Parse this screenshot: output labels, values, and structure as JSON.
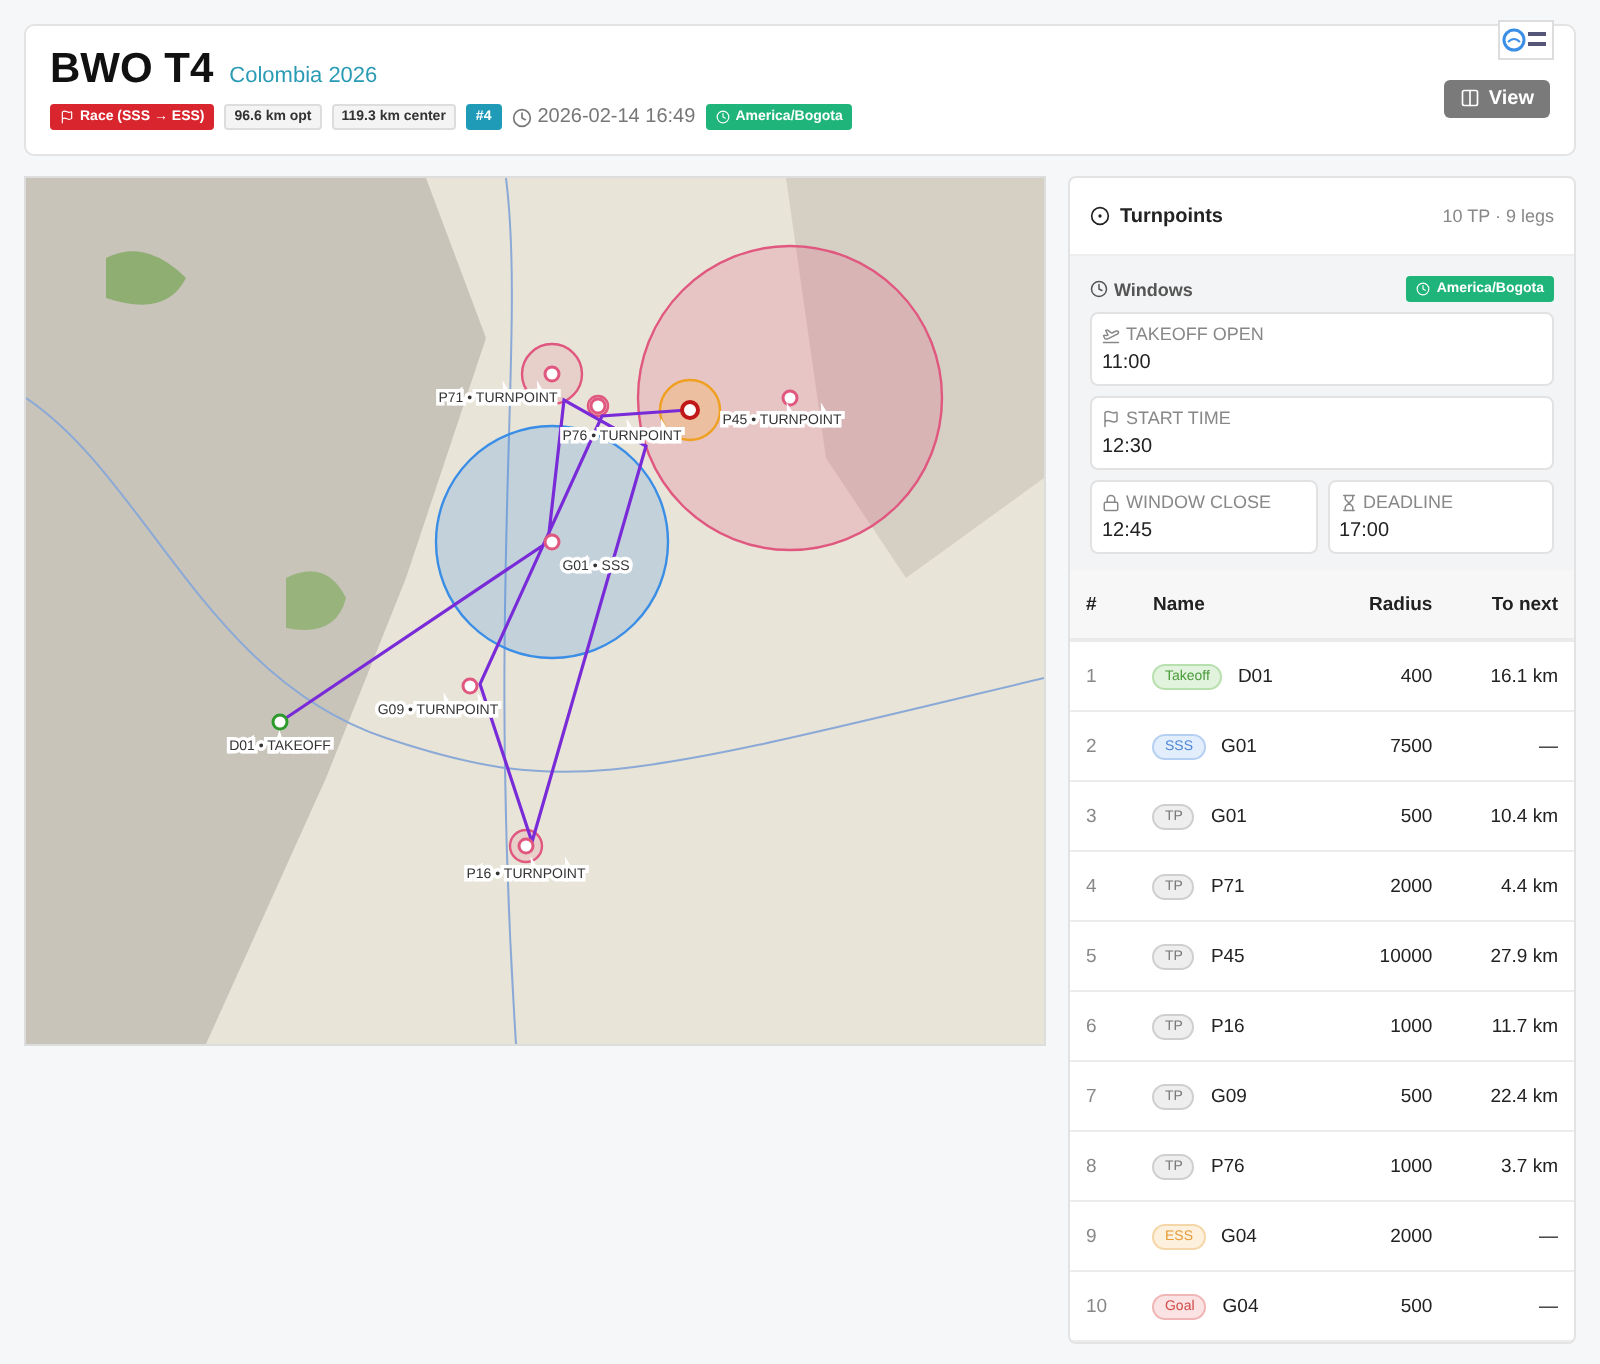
{
  "header": {
    "title": "BWO T4",
    "subtitle": "Colombia 2026",
    "task_type": "Race (SSS → ESS)",
    "distance_opt": "96.6 km opt",
    "distance_center": "119.3 km center",
    "task_number": "#4",
    "datetime": "2026-02-14 16:49",
    "timezone": "America/Bogota",
    "view_button": "View"
  },
  "map": {
    "waypoints": [
      {
        "label": "P71 • TURNPOINT",
        "kind": "tp"
      },
      {
        "label": "P45 • TURNPOINT",
        "kind": "tp"
      },
      {
        "label": "P76 • TURNPOINT",
        "kind": "tp"
      },
      {
        "label": "G01 • SSS",
        "kind": "sss"
      },
      {
        "label": "G09 • TURNPOINT",
        "kind": "tp"
      },
      {
        "label": "D01 • TAKEOFF",
        "kind": "takeoff"
      },
      {
        "label": "P16 • TURNPOINT",
        "kind": "tp"
      }
    ]
  },
  "turnpoints": {
    "title": "Turnpoints",
    "summary": "10 TP · 9 legs",
    "windows": {
      "title": "Windows",
      "timezone": "America/Bogota",
      "items": [
        {
          "kind": "takeoff",
          "label": "TAKEOFF OPEN",
          "time": "11:00"
        },
        {
          "kind": "start",
          "label": "START TIME",
          "time": "12:30"
        },
        {
          "kind": "close",
          "label": "WINDOW CLOSE",
          "time": "12:45"
        },
        {
          "kind": "deadline",
          "label": "DEADLINE",
          "time": "17:00"
        }
      ]
    },
    "columns": [
      "#",
      "Name",
      "Radius",
      "To next"
    ],
    "rows": [
      {
        "n": "1",
        "kind": "takeoff",
        "tag": "Takeoff",
        "name": "D01",
        "radius": "400",
        "to_next": "16.1 km"
      },
      {
        "n": "2",
        "kind": "sss",
        "tag": "SSS",
        "name": "G01",
        "radius": "7500",
        "to_next": "—"
      },
      {
        "n": "3",
        "kind": "tp",
        "tag": "TP",
        "name": "G01",
        "radius": "500",
        "to_next": "10.4 km"
      },
      {
        "n": "4",
        "kind": "tp",
        "tag": "TP",
        "name": "P71",
        "radius": "2000",
        "to_next": "4.4 km"
      },
      {
        "n": "5",
        "kind": "tp",
        "tag": "TP",
        "name": "P45",
        "radius": "10000",
        "to_next": "27.9 km"
      },
      {
        "n": "6",
        "kind": "tp",
        "tag": "TP",
        "name": "P16",
        "radius": "1000",
        "to_next": "11.7 km"
      },
      {
        "n": "7",
        "kind": "tp",
        "tag": "TP",
        "name": "G09",
        "radius": "500",
        "to_next": "22.4 km"
      },
      {
        "n": "8",
        "kind": "tp",
        "tag": "TP",
        "name": "P76",
        "radius": "1000",
        "to_next": "3.7 km"
      },
      {
        "n": "9",
        "kind": "ess",
        "tag": "ESS",
        "name": "G04",
        "radius": "2000",
        "to_next": "—"
      },
      {
        "n": "10",
        "kind": "goal",
        "tag": "Goal",
        "name": "G04",
        "radius": "500",
        "to_next": "—"
      }
    ]
  }
}
